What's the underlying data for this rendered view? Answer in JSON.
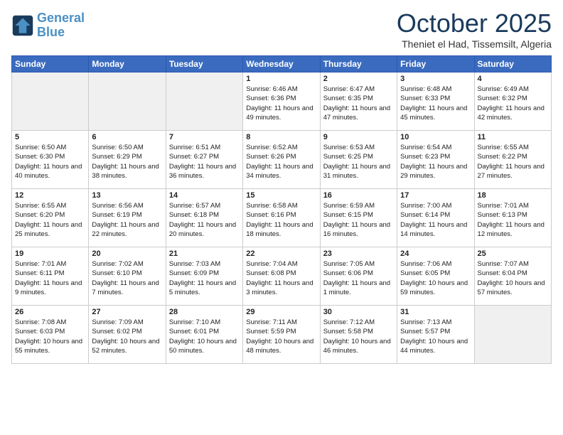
{
  "header": {
    "logo_line1": "General",
    "logo_line2": "Blue",
    "month": "October 2025",
    "location": "Theniet el Had, Tissemsilt, Algeria"
  },
  "weekdays": [
    "Sunday",
    "Monday",
    "Tuesday",
    "Wednesday",
    "Thursday",
    "Friday",
    "Saturday"
  ],
  "weeks": [
    [
      {
        "day": "",
        "info": ""
      },
      {
        "day": "",
        "info": ""
      },
      {
        "day": "",
        "info": ""
      },
      {
        "day": "1",
        "info": "Sunrise: 6:46 AM\nSunset: 6:36 PM\nDaylight: 11 hours and 49 minutes."
      },
      {
        "day": "2",
        "info": "Sunrise: 6:47 AM\nSunset: 6:35 PM\nDaylight: 11 hours and 47 minutes."
      },
      {
        "day": "3",
        "info": "Sunrise: 6:48 AM\nSunset: 6:33 PM\nDaylight: 11 hours and 45 minutes."
      },
      {
        "day": "4",
        "info": "Sunrise: 6:49 AM\nSunset: 6:32 PM\nDaylight: 11 hours and 42 minutes."
      }
    ],
    [
      {
        "day": "5",
        "info": "Sunrise: 6:50 AM\nSunset: 6:30 PM\nDaylight: 11 hours and 40 minutes."
      },
      {
        "day": "6",
        "info": "Sunrise: 6:50 AM\nSunset: 6:29 PM\nDaylight: 11 hours and 38 minutes."
      },
      {
        "day": "7",
        "info": "Sunrise: 6:51 AM\nSunset: 6:27 PM\nDaylight: 11 hours and 36 minutes."
      },
      {
        "day": "8",
        "info": "Sunrise: 6:52 AM\nSunset: 6:26 PM\nDaylight: 11 hours and 34 minutes."
      },
      {
        "day": "9",
        "info": "Sunrise: 6:53 AM\nSunset: 6:25 PM\nDaylight: 11 hours and 31 minutes."
      },
      {
        "day": "10",
        "info": "Sunrise: 6:54 AM\nSunset: 6:23 PM\nDaylight: 11 hours and 29 minutes."
      },
      {
        "day": "11",
        "info": "Sunrise: 6:55 AM\nSunset: 6:22 PM\nDaylight: 11 hours and 27 minutes."
      }
    ],
    [
      {
        "day": "12",
        "info": "Sunrise: 6:55 AM\nSunset: 6:20 PM\nDaylight: 11 hours and 25 minutes."
      },
      {
        "day": "13",
        "info": "Sunrise: 6:56 AM\nSunset: 6:19 PM\nDaylight: 11 hours and 22 minutes."
      },
      {
        "day": "14",
        "info": "Sunrise: 6:57 AM\nSunset: 6:18 PM\nDaylight: 11 hours and 20 minutes."
      },
      {
        "day": "15",
        "info": "Sunrise: 6:58 AM\nSunset: 6:16 PM\nDaylight: 11 hours and 18 minutes."
      },
      {
        "day": "16",
        "info": "Sunrise: 6:59 AM\nSunset: 6:15 PM\nDaylight: 11 hours and 16 minutes."
      },
      {
        "day": "17",
        "info": "Sunrise: 7:00 AM\nSunset: 6:14 PM\nDaylight: 11 hours and 14 minutes."
      },
      {
        "day": "18",
        "info": "Sunrise: 7:01 AM\nSunset: 6:13 PM\nDaylight: 11 hours and 12 minutes."
      }
    ],
    [
      {
        "day": "19",
        "info": "Sunrise: 7:01 AM\nSunset: 6:11 PM\nDaylight: 11 hours and 9 minutes."
      },
      {
        "day": "20",
        "info": "Sunrise: 7:02 AM\nSunset: 6:10 PM\nDaylight: 11 hours and 7 minutes."
      },
      {
        "day": "21",
        "info": "Sunrise: 7:03 AM\nSunset: 6:09 PM\nDaylight: 11 hours and 5 minutes."
      },
      {
        "day": "22",
        "info": "Sunrise: 7:04 AM\nSunset: 6:08 PM\nDaylight: 11 hours and 3 minutes."
      },
      {
        "day": "23",
        "info": "Sunrise: 7:05 AM\nSunset: 6:06 PM\nDaylight: 11 hours and 1 minute."
      },
      {
        "day": "24",
        "info": "Sunrise: 7:06 AM\nSunset: 6:05 PM\nDaylight: 10 hours and 59 minutes."
      },
      {
        "day": "25",
        "info": "Sunrise: 7:07 AM\nSunset: 6:04 PM\nDaylight: 10 hours and 57 minutes."
      }
    ],
    [
      {
        "day": "26",
        "info": "Sunrise: 7:08 AM\nSunset: 6:03 PM\nDaylight: 10 hours and 55 minutes."
      },
      {
        "day": "27",
        "info": "Sunrise: 7:09 AM\nSunset: 6:02 PM\nDaylight: 10 hours and 52 minutes."
      },
      {
        "day": "28",
        "info": "Sunrise: 7:10 AM\nSunset: 6:01 PM\nDaylight: 10 hours and 50 minutes."
      },
      {
        "day": "29",
        "info": "Sunrise: 7:11 AM\nSunset: 5:59 PM\nDaylight: 10 hours and 48 minutes."
      },
      {
        "day": "30",
        "info": "Sunrise: 7:12 AM\nSunset: 5:58 PM\nDaylight: 10 hours and 46 minutes."
      },
      {
        "day": "31",
        "info": "Sunrise: 7:13 AM\nSunset: 5:57 PM\nDaylight: 10 hours and 44 minutes."
      },
      {
        "day": "",
        "info": ""
      }
    ]
  ]
}
